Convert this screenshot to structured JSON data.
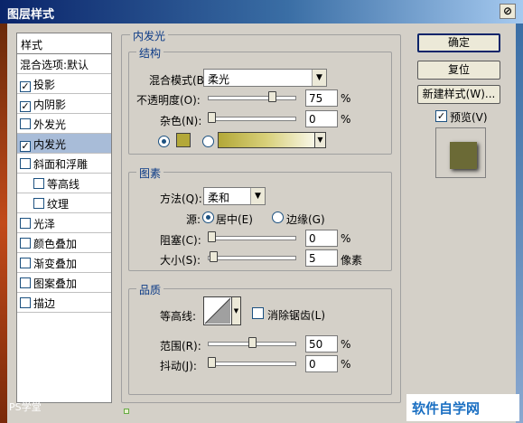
{
  "window": {
    "title": "图层样式",
    "close_label": "⊘"
  },
  "style_list": {
    "header": "样式",
    "items": [
      {
        "label": "混合选项:默认",
        "checkbox": false,
        "checked": false,
        "sub": false,
        "selected": false
      },
      {
        "label": "投影",
        "checkbox": true,
        "checked": true,
        "sub": false,
        "selected": false
      },
      {
        "label": "内阴影",
        "checkbox": true,
        "checked": true,
        "sub": false,
        "selected": false
      },
      {
        "label": "外发光",
        "checkbox": true,
        "checked": false,
        "sub": false,
        "selected": false
      },
      {
        "label": "内发光",
        "checkbox": true,
        "checked": true,
        "sub": false,
        "selected": true
      },
      {
        "label": "斜面和浮雕",
        "checkbox": true,
        "checked": false,
        "sub": false,
        "selected": false
      },
      {
        "label": "等高线",
        "checkbox": true,
        "checked": false,
        "sub": true,
        "selected": false
      },
      {
        "label": "纹理",
        "checkbox": true,
        "checked": false,
        "sub": true,
        "selected": false
      },
      {
        "label": "光泽",
        "checkbox": true,
        "checked": false,
        "sub": false,
        "selected": false
      },
      {
        "label": "颜色叠加",
        "checkbox": true,
        "checked": false,
        "sub": false,
        "selected": false
      },
      {
        "label": "渐变叠加",
        "checkbox": true,
        "checked": false,
        "sub": false,
        "selected": false
      },
      {
        "label": "图案叠加",
        "checkbox": true,
        "checked": false,
        "sub": false,
        "selected": false
      },
      {
        "label": "描边",
        "checkbox": true,
        "checked": false,
        "sub": false,
        "selected": false
      }
    ]
  },
  "inner_glow": {
    "group_title": "内发光",
    "structure": {
      "title": "结构",
      "blend_mode_label": "混合模式(B):",
      "blend_mode_value": "柔光",
      "opacity_label": "不透明度(O):",
      "opacity_value": "75",
      "opacity_fraction": 0.75,
      "opacity_unit": "%",
      "noise_label": "杂色(N):",
      "noise_value": "0",
      "noise_fraction": 0,
      "noise_unit": "%",
      "color_hex": "#b3a838",
      "color_selected": true,
      "gradient_selected": false
    },
    "elements": {
      "title": "图素",
      "method_label": "方法(Q):",
      "method_value": "柔和",
      "source_label": "源:",
      "source_center": "居中(E)",
      "source_edge": "边缘(G)",
      "source_center_selected": true,
      "choke_label": "阻塞(C):",
      "choke_value": "0",
      "choke_fraction": 0,
      "choke_unit": "%",
      "size_label": "大小(S):",
      "size_value": "5",
      "size_fraction": 0.02,
      "size_unit": "像素"
    },
    "quality": {
      "title": "品质",
      "contour_label": "等高线:",
      "anti_alias_label": "消除锯齿(L)",
      "anti_alias_checked": false,
      "range_label": "范围(R):",
      "range_value": "50",
      "range_fraction": 0.5,
      "range_unit": "%",
      "jitter_label": "抖动(J):",
      "jitter_value": "0",
      "jitter_fraction": 0,
      "jitter_unit": "%"
    }
  },
  "buttons": {
    "ok": "确定",
    "reset": "复位",
    "new_style": "新建样式(W)...",
    "preview_label": "预览(V)",
    "preview_checked": true
  },
  "watermarks": {
    "left": "PS学堂",
    "right": "软件自学网"
  }
}
